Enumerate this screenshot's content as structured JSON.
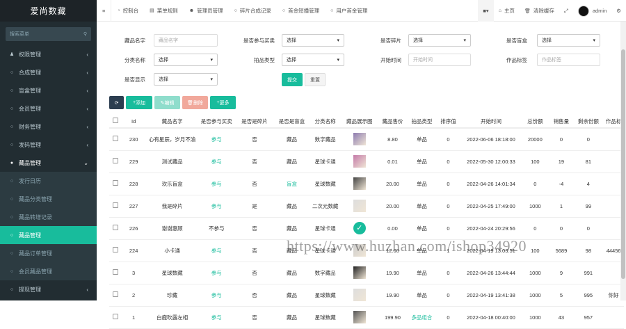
{
  "brand": "爱尚数藏",
  "sidebar": {
    "search_placeholder": "搜索菜单",
    "items": [
      {
        "label": "权限管理",
        "icon": "users-icon"
      },
      {
        "label": "合成管理",
        "icon": "circle-icon"
      },
      {
        "label": "盲盒管理",
        "icon": "circle-icon"
      },
      {
        "label": "会员管理",
        "icon": "circle-icon"
      },
      {
        "label": "财务管理",
        "icon": "circle-icon"
      },
      {
        "label": "发码管理",
        "icon": "circle-icon"
      },
      {
        "label": "藏品管理",
        "icon": "circle-icon"
      }
    ],
    "sub": [
      {
        "label": "发行日历"
      },
      {
        "label": "藏品分类管理"
      },
      {
        "label": "藏品转增记录"
      },
      {
        "label": "藏品管理"
      },
      {
        "label": "藏品订单管理"
      },
      {
        "label": "会员藏品管理"
      }
    ],
    "last": {
      "label": "提现管理"
    }
  },
  "topbar": {
    "tabs": [
      {
        "label": "控制台"
      },
      {
        "label": "菜单规则"
      },
      {
        "label": "管理员管理"
      },
      {
        "label": "碎片合成记录"
      },
      {
        "label": "首金短播管理"
      },
      {
        "label": "用户首金管理"
      }
    ],
    "home": "主页",
    "clear": "清除缓存",
    "user": "admin"
  },
  "form": {
    "name_label": "藏品名字",
    "name_ph": "藏品名字",
    "buy_label": "是否参与买卖",
    "buy_val": "选择",
    "frag_label": "是否碎片",
    "frag_val": "选择",
    "mblind_label": "是否盲盒",
    "mblind_val": "选择",
    "cat_label": "分类名称",
    "cat_val": "选择",
    "auc_label": "拍品类型",
    "auc_val": "选择",
    "start_label": "开始时间",
    "start_ph": "开始时间",
    "series_label": "作品标签",
    "series_ph": "作品标签",
    "show_label": "是否显示",
    "show_val": "选择",
    "submit": "提交",
    "reset": "重置"
  },
  "toolbar": {
    "add": "添加",
    "edit": "编辑",
    "del": "删除",
    "more": "更多"
  },
  "columns": [
    "Id",
    "藏品名字",
    "是否参与买卖",
    "是否是碎片",
    "是否是盲盒",
    "分类名称",
    "藏品展示图",
    "藏品售价",
    "拍品类型",
    "排序值",
    "开始时间",
    "总份额",
    "销售量",
    "剩余份额",
    "作品标"
  ],
  "rows": [
    {
      "id": "230",
      "name": "心有星辰，岁月不渝",
      "buy": "参与",
      "frag": "否",
      "box": "藏品",
      "cat": "数字藏品",
      "price": "8.80",
      "type": "单品",
      "sort": "0",
      "time": "2022-06-06 18:18:00",
      "total": "20000",
      "sold": "0",
      "left": "0",
      "tag": "",
      "thumb": "#8d7bb0"
    },
    {
      "id": "229",
      "name": "测试藏品",
      "buy": "参与",
      "frag": "否",
      "box": "藏品",
      "cat": "星球卡通",
      "price": "0.01",
      "type": "单品",
      "sort": "0",
      "time": "2022-05-30 12:00:33",
      "total": "100",
      "sold": "19",
      "left": "81",
      "tag": "",
      "thumb": "#c47aa8"
    },
    {
      "id": "228",
      "name": "欢乐盲盒",
      "buy": "参与",
      "frag": "否",
      "box": "盲盒",
      "cat": "星球数藏",
      "price": "20.00",
      "type": "单品",
      "sort": "0",
      "time": "2022-04-26 14:01:34",
      "total": "0",
      "sold": "-4",
      "left": "4",
      "tag": "",
      "thumb": "#444"
    },
    {
      "id": "227",
      "name": "我是碎片",
      "buy": "参与",
      "frag": "是",
      "box": "藏品",
      "cat": "二次元数藏",
      "price": "20.00",
      "type": "单品",
      "sort": "0",
      "time": "2022-04-25 17:49:00",
      "total": "1000",
      "sold": "1",
      "left": "99",
      "tag": "",
      "thumb": "#ddd"
    },
    {
      "id": "226",
      "name": "谢谢惠顾",
      "buy": "不参与",
      "frag": "否",
      "box": "藏品",
      "cat": "星球卡通",
      "price": "0.00",
      "type": "单品",
      "sort": "0",
      "time": "2022-04-24 20:29:56",
      "total": "0",
      "sold": "0",
      "left": "0",
      "tag": "",
      "thumb": "#18bc9c"
    },
    {
      "id": "224",
      "name": "小卡通",
      "buy": "参与",
      "frag": "否",
      "box": "藏品",
      "cat": "星球卡通",
      "price": "12.00",
      "type": "单品",
      "sort": "1",
      "time": "2022-04-19 13:03:51",
      "total": "100",
      "sold": "5689",
      "left": "98",
      "tag": "44456",
      "thumb": "#ccc"
    },
    {
      "id": "3",
      "name": "星球数藏",
      "buy": "参与",
      "frag": "否",
      "box": "藏品",
      "cat": "数字藏品",
      "price": "19.90",
      "type": "单品",
      "sort": "0",
      "time": "2022-04-26 13:44:44",
      "total": "1000",
      "sold": "9",
      "left": "991",
      "tag": "",
      "thumb": "#222"
    },
    {
      "id": "2",
      "name": "珍藏",
      "buy": "参与",
      "frag": "否",
      "box": "藏品",
      "cat": "星球数藏",
      "price": "19.90",
      "type": "单品",
      "sort": "0",
      "time": "2022-04-19 13:41:38",
      "total": "1000",
      "sold": "5",
      "left": "995",
      "tag": "你好",
      "thumb": "#ddd"
    },
    {
      "id": "1",
      "name": "白鹿吹露左相",
      "buy": "参与",
      "frag": "否",
      "box": "藏品",
      "cat": "星球数藏",
      "price": "199.90",
      "type": "多品组合",
      "sort": "0",
      "time": "2022-04-18 00:40:00",
      "total": "1000",
      "sold": "43",
      "left": "957",
      "tag": "",
      "thumb": "#555"
    }
  ],
  "watermark": "https://www.huzhan.com/ishop34920"
}
